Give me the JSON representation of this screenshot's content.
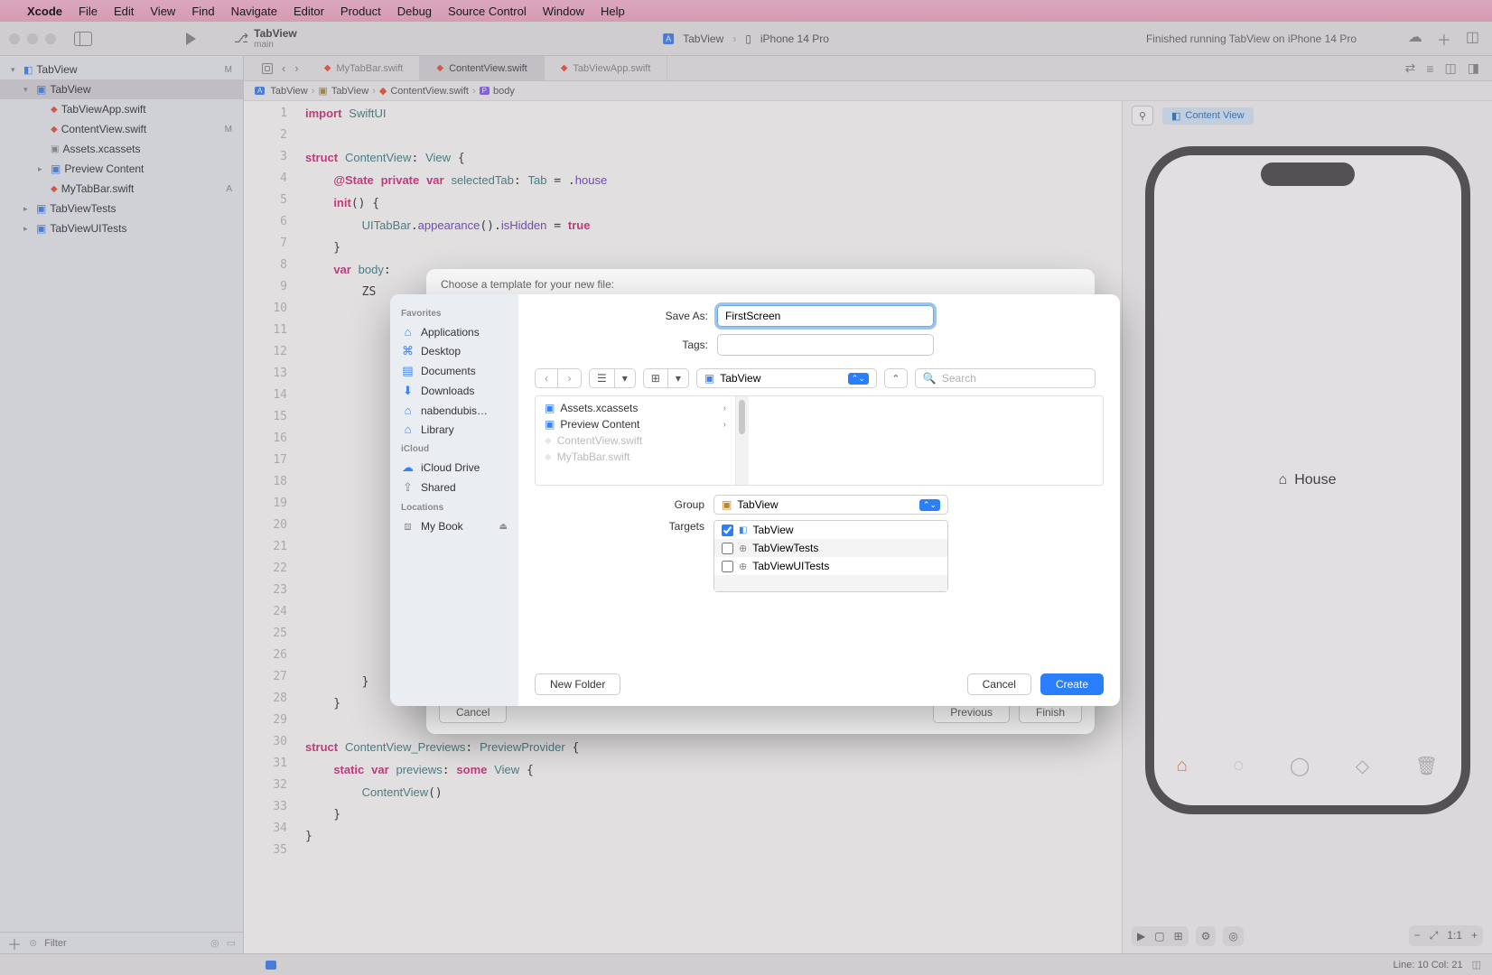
{
  "menubar": {
    "apple": "",
    "app": "Xcode",
    "items": [
      "File",
      "Edit",
      "View",
      "Find",
      "Navigate",
      "Editor",
      "Product",
      "Debug",
      "Source Control",
      "Window",
      "Help"
    ]
  },
  "toolbar": {
    "project_title": "TabView",
    "branch": "main",
    "scheme_app": "TabView",
    "scheme_device": "iPhone 14 Pro",
    "status": "Finished running TabView on iPhone 14 Pro"
  },
  "tabs": {
    "items": [
      {
        "name": "MyTabBar.swift",
        "active": false
      },
      {
        "name": "ContentView.swift",
        "active": true
      },
      {
        "name": "TabViewApp.swift",
        "active": false
      }
    ]
  },
  "breadcrumb": {
    "app": "TabView",
    "folder": "TabView",
    "file": "ContentView.swift",
    "symbol": "body"
  },
  "navigator": {
    "root": {
      "label": "TabView",
      "status": "M"
    },
    "rootFolder": {
      "label": "TabView"
    },
    "files": [
      {
        "label": "TabViewApp.swift",
        "status": ""
      },
      {
        "label": "ContentView.swift",
        "status": "M"
      },
      {
        "label": "Assets.xcassets",
        "status": ""
      },
      {
        "label": "Preview Content",
        "folder": true,
        "status": ""
      },
      {
        "label": "MyTabBar.swift",
        "status": "A"
      }
    ],
    "testFolders": [
      {
        "label": "TabViewTests"
      },
      {
        "label": "TabViewUITests"
      }
    ],
    "filter_placeholder": "Filter"
  },
  "code": {
    "lines": [
      "import SwiftUI",
      "",
      "struct ContentView: View {",
      "    @State private var selectedTab: Tab = .house",
      "    init() {",
      "        UITabBar.appearance().isHidden = true",
      "    }",
      "    var body:",
      "        ZS",
      "",
      "",
      "",
      "",
      "",
      "",
      "",
      "",
      "",
      "",
      "",
      "",
      "",
      "",
      "",
      "",
      "",
      "        }",
      "    }",
      "",
      "struct ContentView_Previews: PreviewProvider {",
      "    static var previews: some View {",
      "        ContentView()",
      "    }",
      "}",
      ""
    ]
  },
  "preview": {
    "chip": "Content View",
    "label": "House"
  },
  "statusbar": {
    "line_col": "Line: 10  Col: 21"
  },
  "template_sheet": {
    "title": "Choose a template for your new file:",
    "cancel": "Cancel",
    "previous": "Previous",
    "finish": "Finish"
  },
  "save_sheet": {
    "save_as_label": "Save As:",
    "save_as_value": "FirstScreen",
    "tags_label": "Tags:",
    "tags_value": "",
    "location": "TabView",
    "search_placeholder": "Search",
    "favorites_heading": "Favorites",
    "favorites": [
      {
        "icon": "⌂",
        "label": "Applications",
        "iconClass": ""
      },
      {
        "icon": "⌘",
        "label": "Desktop"
      },
      {
        "icon": "▤",
        "label": "Documents"
      },
      {
        "icon": "⬇",
        "label": "Downloads"
      },
      {
        "icon": "⌂",
        "label": "nabendubis…"
      }
    ],
    "library_heading": "",
    "library": {
      "icon": "⌂",
      "label": "Library"
    },
    "icloud_heading": "iCloud",
    "icloud_items": [
      {
        "icon": "☁",
        "label": "iCloud Drive"
      },
      {
        "icon": "⇪",
        "label": "Shared",
        "gray": true
      }
    ],
    "locations_heading": "Locations",
    "locations": [
      {
        "icon": "⧈",
        "label": "My Book",
        "eject": true
      }
    ],
    "browser": [
      {
        "icon": "folder",
        "label": "Assets.xcassets",
        "chev": true
      },
      {
        "icon": "folder",
        "label": "Preview Content",
        "chev": true
      },
      {
        "icon": "swift",
        "label": "ContentView.swift",
        "dim": true
      },
      {
        "icon": "swift",
        "label": "MyTabBar.swift",
        "dim": true
      }
    ],
    "group_label": "Group",
    "group_value": "TabView",
    "targets_label": "Targets",
    "targets": [
      {
        "checked": true,
        "icon": "app",
        "label": "TabView"
      },
      {
        "checked": false,
        "icon": "test",
        "label": "TabViewTests"
      },
      {
        "checked": false,
        "icon": "test",
        "label": "TabViewUITests"
      }
    ],
    "new_folder": "New Folder",
    "cancel": "Cancel",
    "create": "Create"
  }
}
